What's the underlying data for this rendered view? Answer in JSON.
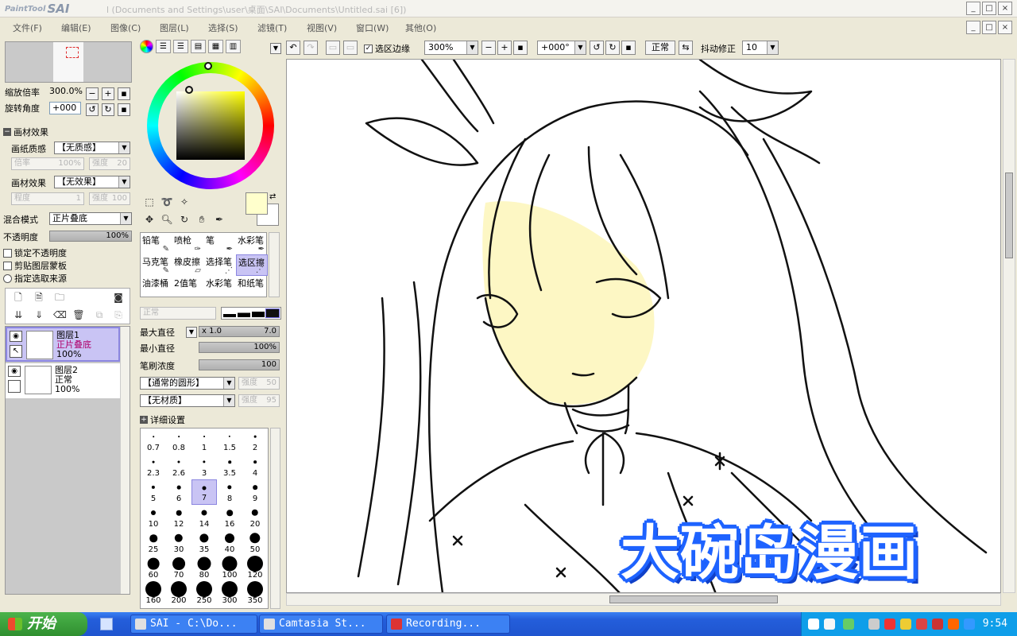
{
  "window": {
    "logo_small": "PaintTool",
    "logo_big": "SAI",
    "doc_title": "l  (Documents and Settings\\user\\桌面\\SAI\\Documents\\Untitled.sai  [6])",
    "btn_min": "_",
    "btn_max": "□",
    "btn_close": "×"
  },
  "menu": [
    "文件(F)",
    "编辑(E)",
    "图像(C)",
    "图层(L)",
    "选择(S)",
    "滤镜(T)",
    "视图(V)",
    "窗口(W)",
    "其他(O)"
  ],
  "navigator": {
    "zoom_label": "缩放倍率",
    "zoom_value": "300.0%",
    "rotate_label": "旋转角度",
    "rotate_value": "+000"
  },
  "material": {
    "section_title": "画材效果",
    "paper_label": "画纸质感",
    "paper_value": "【无质感】",
    "scale_label": "倍率",
    "scale_value": "100%",
    "strength_label": "强度",
    "strength_value": "20",
    "effect_label": "画材效果",
    "effect_value": "【无效果】",
    "degree_label": "程度",
    "degree_value": "1",
    "strength2_label": "强度",
    "strength2_value": "100"
  },
  "layer_props": {
    "blend_label": "混合模式",
    "blend_value": "正片叠底",
    "opacity_label": "不透明度",
    "opacity_value": "100%",
    "opacity_fraction": 1.0,
    "lock_opacity": "锁定不透明度",
    "clip_group": "剪贴图层蒙板",
    "selection_source": "指定选取来源"
  },
  "layers": [
    {
      "name": "图层1",
      "mode": "正片叠底",
      "opacity": "100%",
      "selected": true
    },
    {
      "name": "图层2",
      "mode": "正常",
      "opacity": "100%",
      "selected": false
    }
  ],
  "brush_tools": [
    {
      "name": "铅笔",
      "icon": "✎"
    },
    {
      "name": "喷枪",
      "icon": "✑"
    },
    {
      "name": "笔",
      "icon": "✒"
    },
    {
      "name": "水彩笔",
      "icon": "✒"
    },
    {
      "name": "马克笔",
      "icon": "✎"
    },
    {
      "name": "橡皮擦",
      "icon": "▱"
    },
    {
      "name": "选择笔",
      "icon": "⋰"
    },
    {
      "name": "选区擦",
      "icon": "⋰",
      "selected": true
    },
    {
      "name": "油漆桶",
      "icon": ""
    },
    {
      "name": "2值笔",
      "icon": ""
    },
    {
      "name": "水彩笔",
      "icon": ""
    },
    {
      "name": "和纸笔",
      "icon": ""
    }
  ],
  "brush_settings": {
    "mode_value": "正常",
    "max_diameter_label": "最大直径",
    "max_diameter_mult": "x 1.0",
    "max_diameter_value": "7.0",
    "min_diameter_label": "最小直径",
    "min_diameter_value": "100%",
    "density_label": "笔刷浓度",
    "density_value": "100",
    "shape_value": "【通常的圆形】",
    "shape_strength_label": "强度",
    "shape_strength_value": "50",
    "texture_value": "【无材质】",
    "texture_strength_label": "强度",
    "texture_strength_value": "95",
    "detail_settings": "详细设置"
  },
  "brush_sizes": [
    "0.7",
    "0.8",
    "1",
    "1.5",
    "2",
    "2.3",
    "2.6",
    "3",
    "3.5",
    "4",
    "5",
    "6",
    "7",
    "8",
    "9",
    "10",
    "12",
    "14",
    "16",
    "20",
    "25",
    "30",
    "35",
    "40",
    "50",
    "60",
    "70",
    "80",
    "100",
    "120",
    "160",
    "200",
    "250",
    "300",
    "350"
  ],
  "selected_size": "7",
  "canvas_toolbar": {
    "selection_edge_label": "选区边缘",
    "zoom_value": "300%",
    "rotate_value": "+000°",
    "blend_value": "正常",
    "stabilizer_label": "抖动修正",
    "stabilizer_value": "10"
  },
  "watermark": "大碗岛漫画",
  "taskbar": {
    "start_label": "开始",
    "tasks": [
      "SAI - C:\\Do...",
      "Camtasia St...",
      "Recording..."
    ],
    "clock": "9:54"
  },
  "colors": {
    "foreground": "#ffffcc",
    "background": "#ffffff",
    "selection": "#c9c4f4",
    "skin_fill": "#fdf7c4",
    "watermark_outline": "#1e63ff"
  }
}
